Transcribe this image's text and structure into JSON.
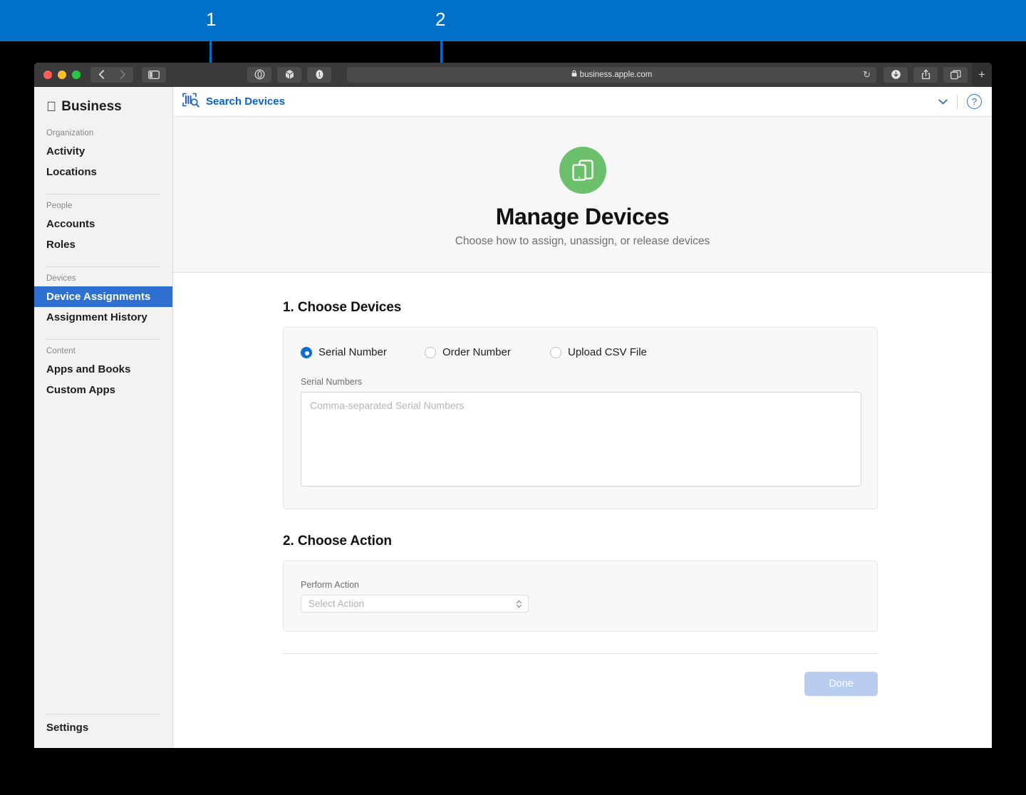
{
  "callouts": [
    {
      "label": "1",
      "target": "sidebar-device-assignments"
    },
    {
      "label": "2",
      "target": "choose-devices-options"
    }
  ],
  "browser": {
    "url": "business.apple.com",
    "lock_icon": "lock-icon",
    "reload_icon": "reload-icon",
    "back_icon": "back-chevron-icon",
    "forward_icon": "forward-chevron-icon",
    "sidebar_icon": "sidebar-toggle-icon",
    "privacy_icon": "privacy-report-icon",
    "extensions_icon": "extensions-icon",
    "tabgroup_icon": "tab-group-icon",
    "downloads_icon": "downloads-icon",
    "share_icon": "share-icon",
    "tabs_icon": "show-tabs-icon",
    "newtab_label": "+"
  },
  "sidebar": {
    "brand": "Business",
    "groups": [
      {
        "head": "Organization",
        "items": [
          {
            "label": "Activity",
            "active": false
          },
          {
            "label": "Locations",
            "active": false
          }
        ]
      },
      {
        "head": "People",
        "items": [
          {
            "label": "Accounts",
            "active": false
          },
          {
            "label": "Roles",
            "active": false
          }
        ]
      },
      {
        "head": "Devices",
        "items": [
          {
            "label": "Device Assignments",
            "active": true
          },
          {
            "label": "Assignment History",
            "active": false
          }
        ]
      },
      {
        "head": "Content",
        "items": [
          {
            "label": "Apps and Books",
            "active": false
          },
          {
            "label": "Custom Apps",
            "active": false
          }
        ]
      }
    ],
    "settings": "Settings"
  },
  "toolbar": {
    "search_label": "Search Devices",
    "search_icon": "barcode-scan-search-icon",
    "chevron_icon": "chevron-down-icon",
    "help_icon": "help-question-icon",
    "help_glyph": "?"
  },
  "hero": {
    "icon": "devices-icon",
    "title": "Manage Devices",
    "subtitle": "Choose how to assign, unassign, or release devices",
    "accent_color": "#6cc06c"
  },
  "step1": {
    "title": "1. Choose Devices",
    "options": [
      {
        "label": "Serial Number",
        "selected": true
      },
      {
        "label": "Order Number",
        "selected": false
      },
      {
        "label": "Upload CSV File",
        "selected": false
      }
    ],
    "field_label": "Serial Numbers",
    "textarea_value": "",
    "textarea_placeholder": "Comma-separated Serial Numbers"
  },
  "step2": {
    "title": "2. Choose Action",
    "field_label": "Perform Action",
    "select_value": "Select Action",
    "stepper_icon": "up-down-stepper-icon"
  },
  "footer": {
    "done_label": "Done"
  },
  "colors": {
    "accent_blue": "#0070C9",
    "sidebar_active": "#2d70d2",
    "link_blue": "#0a62d0",
    "done_disabled": "#b9cdf0"
  }
}
